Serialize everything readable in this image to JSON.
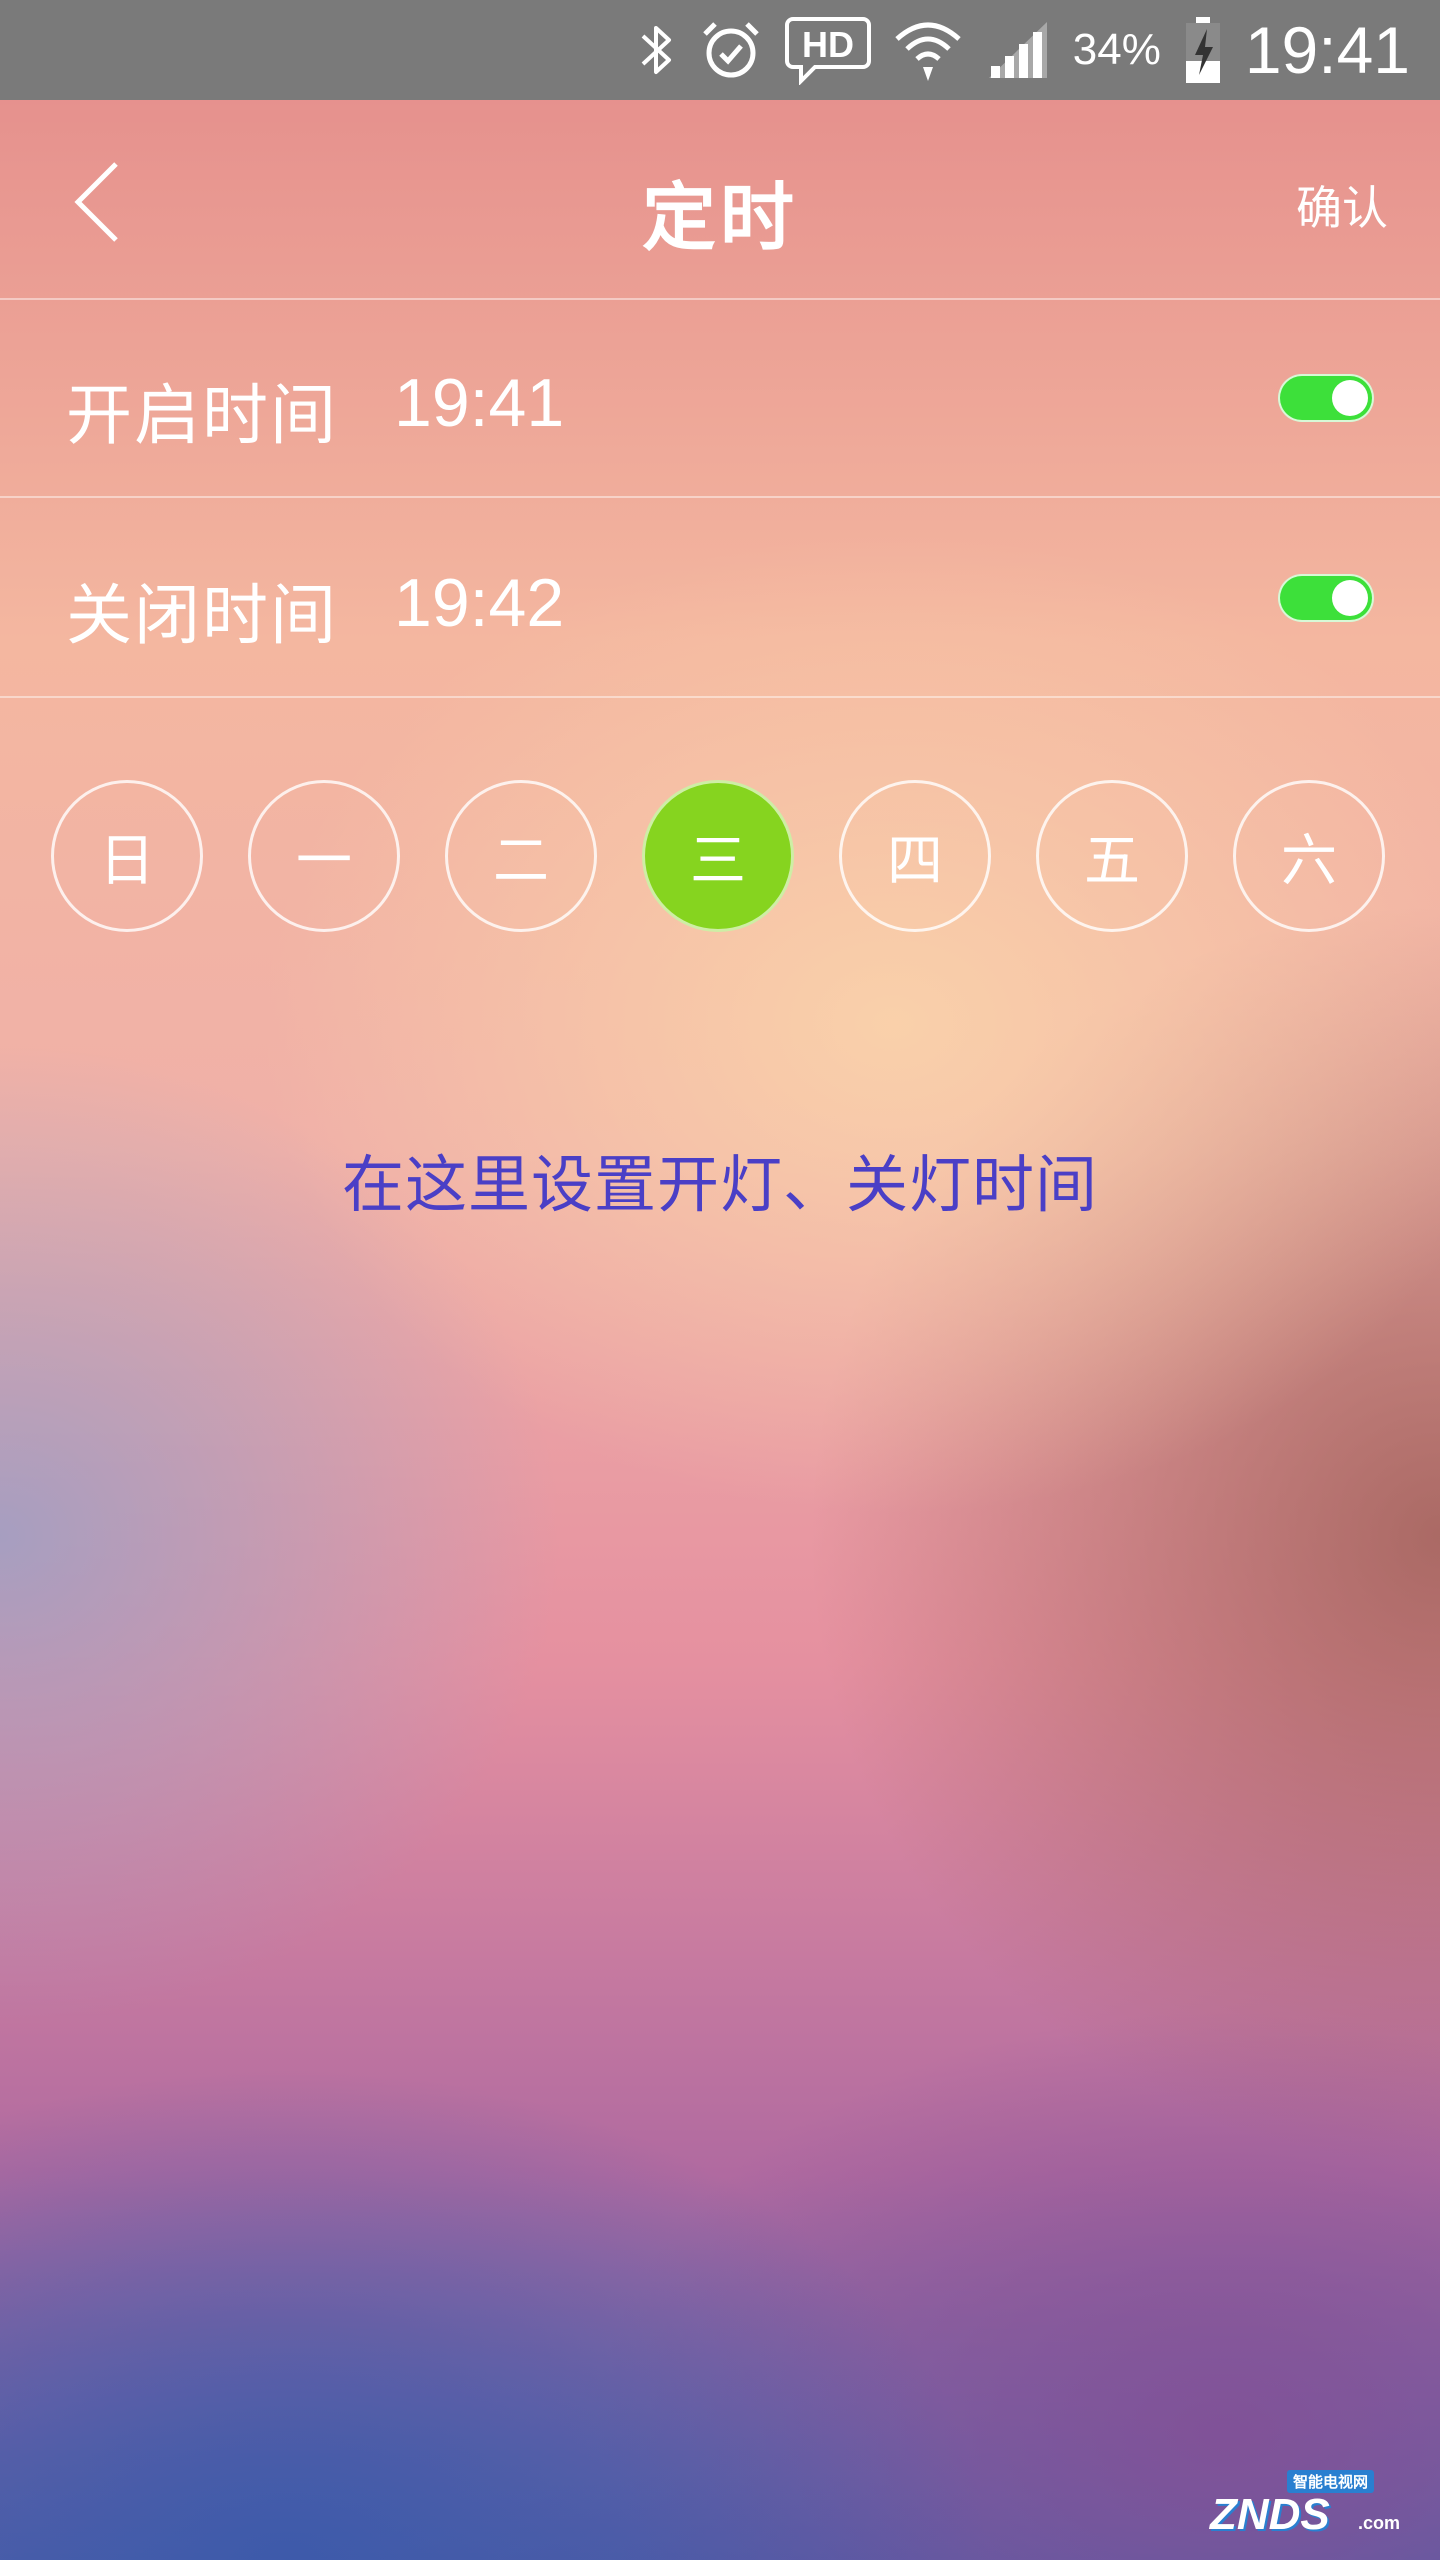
{
  "status_bar": {
    "icons": [
      "bluetooth-icon",
      "alarm-icon",
      "hd-voice-icon",
      "wifi-icon",
      "signal-icon",
      "battery-charging-icon"
    ],
    "battery": "34%",
    "time": "19:41"
  },
  "header": {
    "back_icon": "chevron-left-icon",
    "title": "定时",
    "confirm_label": "确认"
  },
  "rows": [
    {
      "label": "开启时间",
      "time": "19:41",
      "enabled": true
    },
    {
      "label": "关闭时间",
      "time": "19:42",
      "enabled": true
    }
  ],
  "weekdays": [
    {
      "label": "日",
      "selected": false
    },
    {
      "label": "一",
      "selected": false
    },
    {
      "label": "二",
      "selected": false
    },
    {
      "label": "三",
      "selected": true
    },
    {
      "label": "四",
      "selected": false
    },
    {
      "label": "五",
      "selected": false
    },
    {
      "label": "六",
      "selected": false
    }
  ],
  "hint": "在这里设置开灯、关灯时间",
  "watermark": {
    "small": "智能电视网",
    "big": "ZNDS",
    "suffix": ".com"
  },
  "colors": {
    "toggle_on": "#3de03a",
    "day_selected": "#86d41f",
    "hint_text": "#4a3fc6",
    "status_bar_bg": "#7a7a7a"
  }
}
